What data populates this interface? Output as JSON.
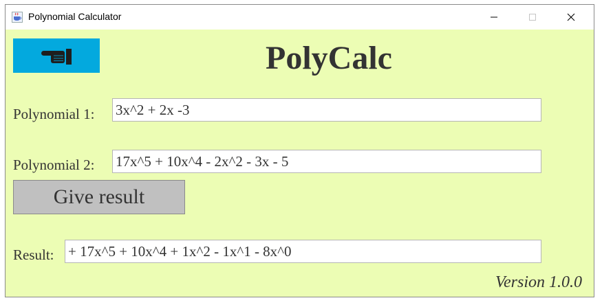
{
  "window": {
    "title": "Polynomial Calculator",
    "controls": {
      "minimize": "—",
      "maximize": "☐",
      "close": "✕"
    }
  },
  "app": {
    "heading": "PolyCalc",
    "back_button_icon": "pointing-hand-icon",
    "back_button_color": "#03a9de",
    "background_color": "#ecfdb4"
  },
  "form": {
    "poly1_label": "Polynomial 1:",
    "poly1_value": "3x^2 + 2x -3",
    "poly2_label": "Polynomial 2:",
    "poly2_value": "17x^5 + 10x^4 - 2x^2 - 3x - 5",
    "give_result_label": "Give result",
    "result_label": "Result:",
    "result_value": "+ 17x^5 + 10x^4 + 1x^2 - 1x^1 - 8x^0"
  },
  "footer": {
    "version": "Version 1.0.0"
  }
}
